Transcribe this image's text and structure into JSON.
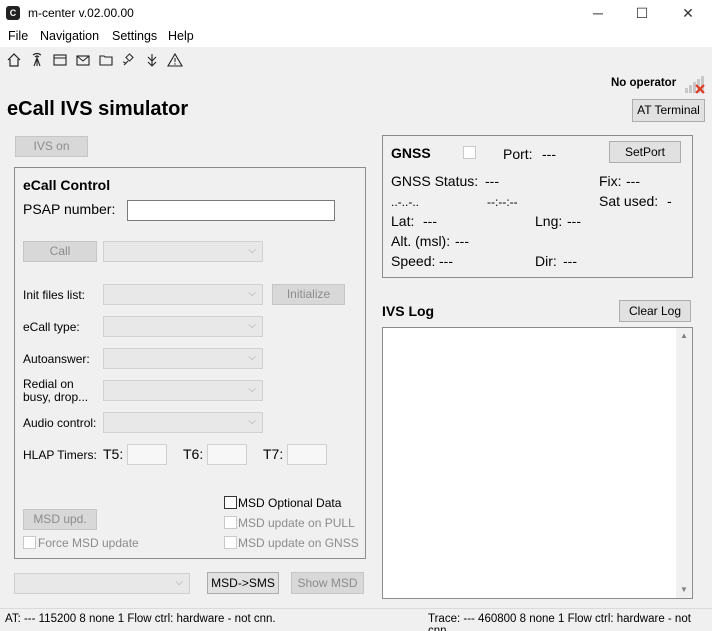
{
  "window": {
    "title": "m-center v.02.00.00",
    "minimize": "─",
    "maximize": "☐",
    "close": "✕"
  },
  "menu": [
    "File",
    "Navigation",
    "Settings",
    "Help"
  ],
  "toolbar_icons": [
    "home-icon",
    "antenna-icon",
    "window-icon",
    "mail-icon",
    "folder-icon",
    "satellite-icon",
    "download-antenna-icon",
    "warning-icon"
  ],
  "header": {
    "title": "eCall IVS simulator",
    "operator": "No operator",
    "at_terminal": "AT Terminal"
  },
  "ivs_on": "IVS on",
  "ecall": {
    "title": "eCall Control",
    "psap_label": "PSAP number:",
    "psap_value": "",
    "call": "Call",
    "init_files_label": "Init files list:",
    "initialize": "Initialize",
    "ecall_type_label": "eCall type:",
    "autoanswer_label": "Autoanswer:",
    "redial_label_1": "Redial on",
    "redial_label_2": "busy, drop...",
    "audio_label": "Audio control:",
    "hlap_label": "HLAP Timers:",
    "t5": "T5:",
    "t6": "T6:",
    "t7": "T7:",
    "msd_optional": "MSD Optional Data",
    "msd_upd": "MSD upd.",
    "msd_pull": "MSD update on PULL",
    "force_msd": "Force MSD update",
    "msd_gnss": "MSD update on GNSS"
  },
  "bottom": {
    "msd_sms": "MSD->SMS",
    "show_msd": "Show MSD"
  },
  "gnss": {
    "title": "GNSS",
    "port_label": "Port:",
    "port_value": "---",
    "setport": "SetPort",
    "status_label": "GNSS Status:",
    "status_value": "---",
    "fix_label": "Fix:",
    "fix_value": "---",
    "date_value": "..-..-..",
    "time_value": "--:--:--",
    "sat_label": "Sat used:",
    "sat_value": "-",
    "lat_label": "Lat:",
    "lat_value": "---",
    "lng_label": "Lng:",
    "lng_value": "---",
    "alt_label": "Alt. (msl):",
    "alt_value": "---",
    "speed_label": "Speed:",
    "speed_value": "---",
    "dir_label": "Dir:",
    "dir_value": "---"
  },
  "log": {
    "title": "IVS Log",
    "clear": "Clear Log"
  },
  "status": {
    "at": "AT: --- 115200 8 none 1 Flow ctrl: hardware - not cnn.",
    "trace": "Trace: --- 460800 8 none 1 Flow ctrl: hardware - not cnn."
  },
  "colors": {
    "panel_bg": "#f0f0f0",
    "disabled_text": "#8c8c8c",
    "signal_x": "#e03c1f"
  }
}
